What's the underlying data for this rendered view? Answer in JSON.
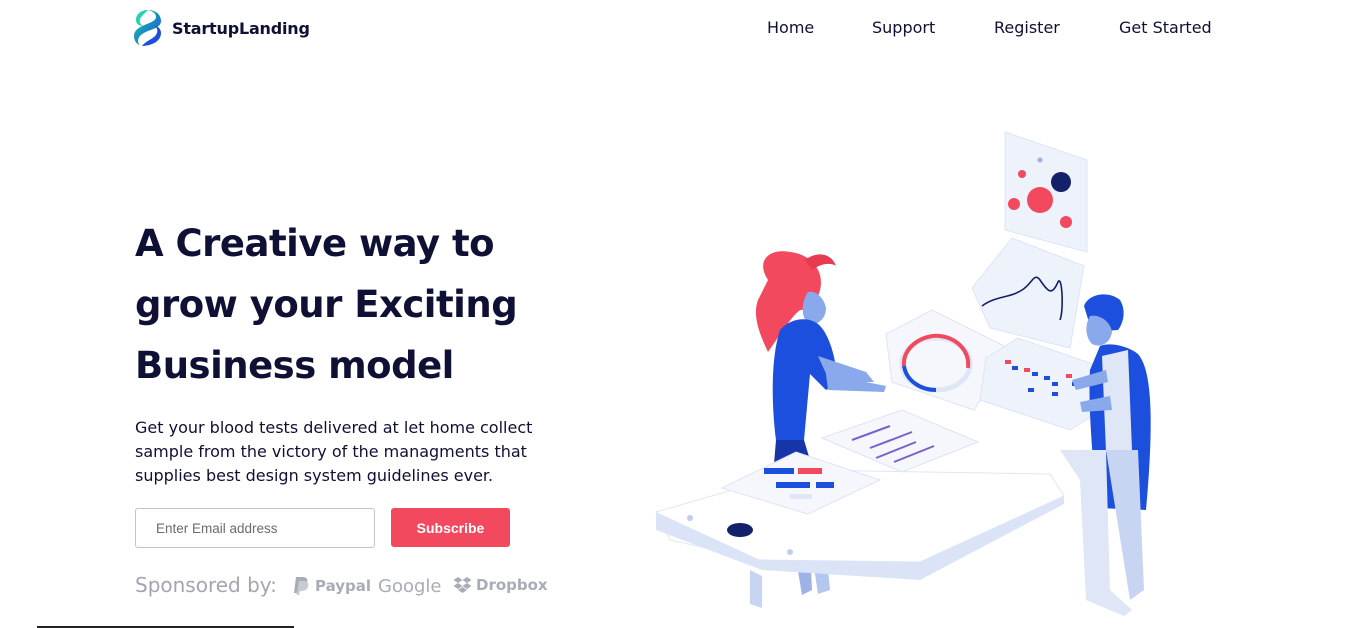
{
  "brand": {
    "name": "StartupLanding",
    "logo_icon": "leaf-logo-icon"
  },
  "nav": {
    "items": [
      {
        "label": "Home"
      },
      {
        "label": "Support"
      },
      {
        "label": "Register"
      },
      {
        "label": "Get Started"
      }
    ]
  },
  "hero": {
    "title_lines": [
      "A Creative way to",
      "grow your Exciting",
      "Business model"
    ],
    "description": "Get your blood tests delivered at let home collect sample from the victory of the managments that supplies best design system guidelines ever.",
    "email_placeholder": "Enter Email address",
    "subscribe_label": "Subscribe"
  },
  "sponsors": {
    "label": "Sponsored by:",
    "items": [
      {
        "name": "Paypal",
        "icon": "paypal-icon"
      },
      {
        "name": "Google",
        "icon": ""
      },
      {
        "name": "Dropbox",
        "icon": "dropbox-icon"
      }
    ]
  },
  "colors": {
    "primary_text": "#0f1035",
    "accent": "#f2495e",
    "illustration_blue": "#1c4fdd",
    "muted": "#a8acb6"
  }
}
